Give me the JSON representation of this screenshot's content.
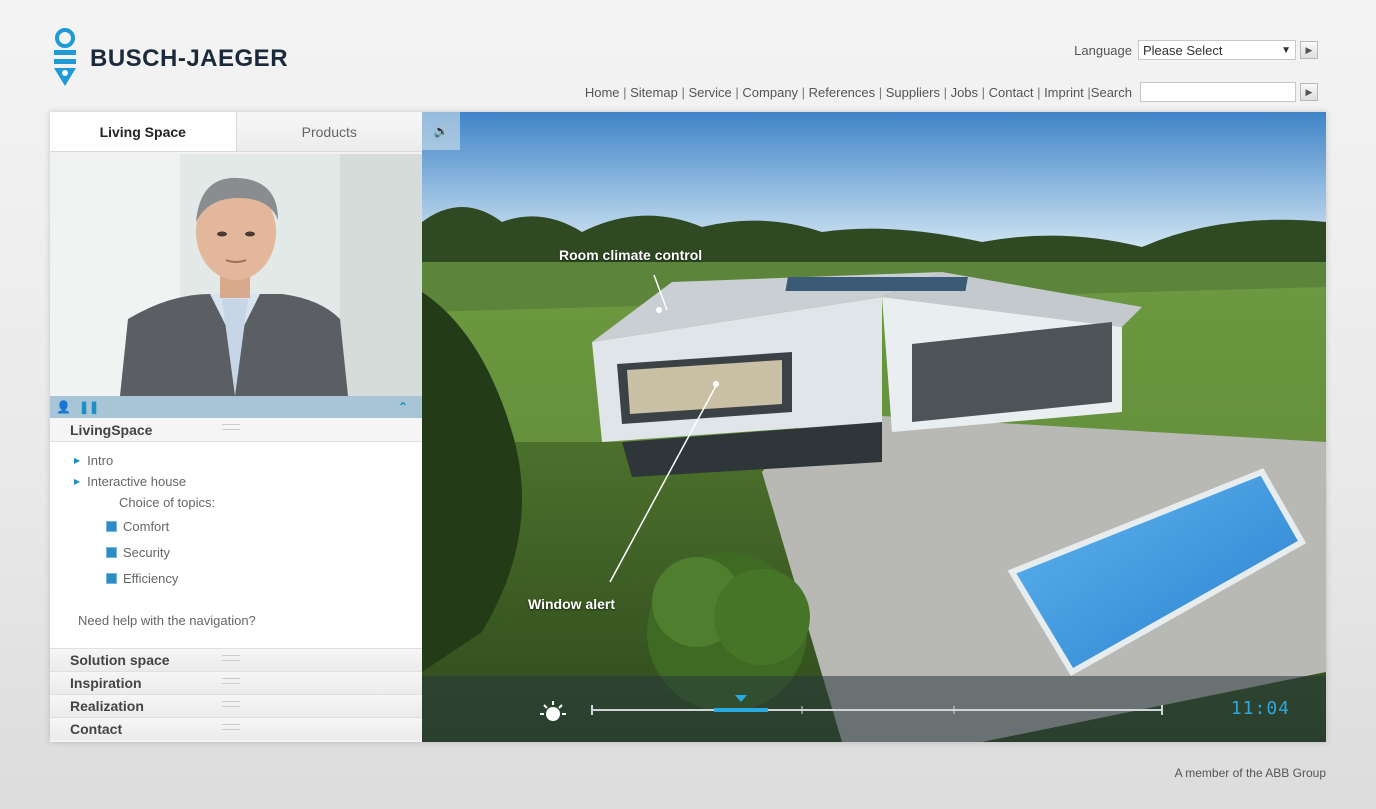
{
  "brand": {
    "name": "BUSCH-JAEGER"
  },
  "language": {
    "label": "Language",
    "selected": "Please Select"
  },
  "topnav": {
    "links": [
      "Home",
      "Sitemap",
      "Service",
      "Company",
      "References",
      "Suppliers",
      "Jobs",
      "Contact",
      "Imprint",
      "Search"
    ]
  },
  "tabs": [
    {
      "label": "Living Space",
      "active": true
    },
    {
      "label": "Products",
      "active": false
    }
  ],
  "video_controls": {
    "icons": [
      "presenter-icon",
      "pause-icon",
      "collapse-up-icon"
    ]
  },
  "sidebar": {
    "section": "LivingSpace",
    "items": [
      {
        "label": "Intro"
      },
      {
        "label": "Interactive house"
      }
    ],
    "topics_label": "Choice of topics:",
    "topics": [
      {
        "label": "Comfort",
        "checked": true
      },
      {
        "label": "Security",
        "checked": true
      },
      {
        "label": "Efficiency",
        "checked": true
      }
    ],
    "help": "Need help with the navigation?",
    "accordion": [
      "Solution space",
      "Inspiration",
      "Realization",
      "Contact"
    ]
  },
  "scene": {
    "hotspots": [
      "Room climate control",
      "Window alert"
    ],
    "time": "11:04",
    "accent": "#2aa8e0"
  },
  "footer": {
    "text": "A member of the ABB Group"
  }
}
